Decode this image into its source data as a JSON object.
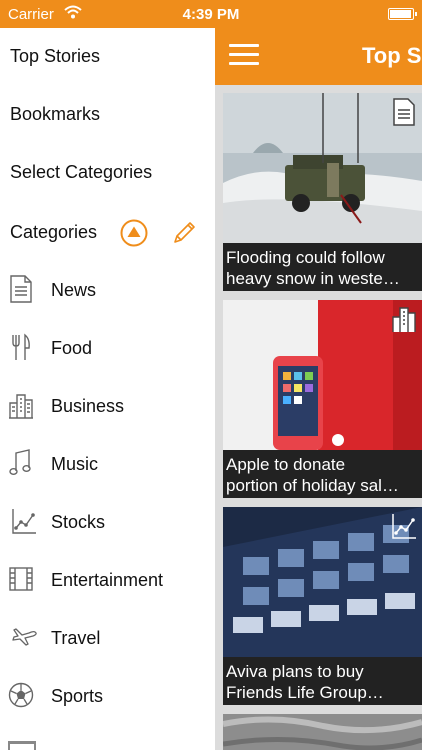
{
  "status_bar": {
    "carrier": "Carrier",
    "time": "4:39 PM",
    "battery_level": 0.9
  },
  "menu": {
    "top_stories": "Top Stories",
    "bookmarks": "Bookmarks",
    "select_categories": "Select Categories",
    "categories_header": "Categories",
    "categories": [
      {
        "label": "News",
        "icon": "newspaper-icon"
      },
      {
        "label": "Food",
        "icon": "fork-knife-icon"
      },
      {
        "label": "Business",
        "icon": "buildings-icon"
      },
      {
        "label": "Music",
        "icon": "music-note-icon"
      },
      {
        "label": "Stocks",
        "icon": "stock-chart-icon"
      },
      {
        "label": "Entertainment",
        "icon": "film-strip-icon"
      },
      {
        "label": "Travel",
        "icon": "airplane-icon"
      },
      {
        "label": "Sports",
        "icon": "soccer-ball-icon"
      }
    ]
  },
  "navbar": {
    "title": "Top S"
  },
  "stories": [
    {
      "line1": "Flooding could follow",
      "line2": "heavy snow in weste…",
      "badge": "newspaper-icon"
    },
    {
      "line1": "Apple to donate",
      "line2": "portion of holiday sal…",
      "badge": "buildings-icon"
    },
    {
      "line1": "Aviva plans to buy",
      "line2": "Friends Life Group…",
      "badge": "stock-chart-icon"
    }
  ],
  "colors": {
    "accent": "#ef8d1b",
    "caption_bg": "#222222"
  }
}
